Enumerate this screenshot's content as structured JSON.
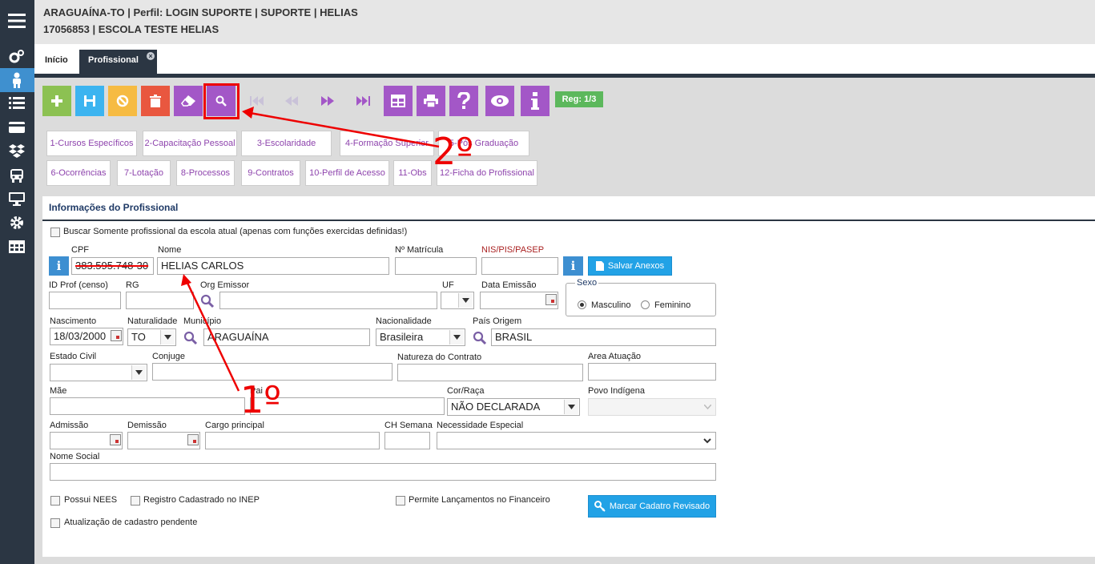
{
  "header": {
    "line1": "ARAGUAÍNA-TO | Perfil: LOGIN SUPORTE | SUPORTE | HELIAS",
    "line2": "17056853 | ESCOLA TESTE HELIAS"
  },
  "sidebar": {
    "items": [
      "menu-icon",
      "cogs-icon",
      "user-icon",
      "list-icon",
      "card-icon",
      "dropbox-icon",
      "bus-icon",
      "monitor-icon",
      "gear-icon",
      "table-icon"
    ]
  },
  "tabs": [
    {
      "label": "Início"
    },
    {
      "label": "Profissional",
      "close": "×"
    }
  ],
  "toolbar": {
    "reg": "Reg: 1/3",
    "colors": {
      "add": "#8cc152",
      "save": "#3cb4f0",
      "cancel": "#f6bb42",
      "delete": "#e9573f",
      "purple": "#a357c7"
    }
  },
  "subtabs_row1": [
    "1-Cursos Específicos",
    "2-Capacitação Pessoal",
    "3-Escolaridade",
    "4-Formação Superior",
    "5-Pós Graduação"
  ],
  "subtabs_row2": [
    "6-Ocorrências",
    "7-Lotação",
    "8-Processos",
    "9-Contratos",
    "10-Perfil de Acesso",
    "11-Obs",
    "12-Ficha do Profissional"
  ],
  "panel": {
    "title": "Informações do Profissional",
    "buscar": "Buscar Somente profissional da escola atual (apenas com funções exercidas definidas!)",
    "cpf": {
      "label": "CPF",
      "value": "383.595.748-30"
    },
    "nome": {
      "label": "Nome",
      "value": "HELIAS CARLOS"
    },
    "matricula": {
      "label": "Nº Matrícula",
      "value": ""
    },
    "nis": {
      "label": "NIS/PIS/PASEP",
      "value": ""
    },
    "salvar_anexos": "Salvar Anexos",
    "id_prof": {
      "label": "ID Prof (censo)",
      "value": ""
    },
    "rg": {
      "label": "RG",
      "value": ""
    },
    "org_emissor": {
      "label": "Org Emissor",
      "value": ""
    },
    "uf": {
      "label": "UF",
      "value": ""
    },
    "data_emissao": {
      "label": "Data Emissão",
      "value": ""
    },
    "sexo": {
      "label": "Sexo",
      "masculino": "Masculino",
      "feminino": "Feminino"
    },
    "nascimento": {
      "label": "Nascimento",
      "value": "18/03/2000"
    },
    "naturalidade": {
      "label": "Naturalidade",
      "value": "TO"
    },
    "municipio": {
      "label": "Município",
      "value": "ARAGUAÍNA"
    },
    "nacionalidade": {
      "label": "Nacionalidade",
      "value": "Brasileira"
    },
    "pais_origem": {
      "label": "País Origem",
      "value": "BRASIL"
    },
    "estado_civil": {
      "label": "Estado Civil",
      "value": ""
    },
    "conjuge": {
      "label": "Conjuge",
      "value": ""
    },
    "natureza": {
      "label": "Natureza do Contrato",
      "value": ""
    },
    "area": {
      "label": "Area Atuação",
      "value": ""
    },
    "mae": {
      "label": "Mãe",
      "value": ""
    },
    "pai": {
      "label": "Pai",
      "value": ""
    },
    "cor_raca": {
      "label": "Cor/Raça",
      "value": "NÃO DECLARADA"
    },
    "povo": {
      "label": "Povo Indígena",
      "value": ""
    },
    "admissao": {
      "label": "Admissão",
      "value": ""
    },
    "demissao": {
      "label": "Demissão",
      "value": ""
    },
    "cargo": {
      "label": "Cargo principal",
      "value": ""
    },
    "ch_semana": {
      "label": "CH Semana",
      "value": ""
    },
    "necessidade": {
      "label": "Necessidade Especial",
      "value": ""
    },
    "nome_social": {
      "label": "Nome Social",
      "value": ""
    },
    "possui_nees": "Possui NEES",
    "registro_inep": "Registro Cadastrado no INEP",
    "permite_lanc": "Permite Lançamentos no Financeiro",
    "atualizacao": "Atualização de cadastro pendente",
    "marcar": "Marcar Cadatro Revisado"
  },
  "annotations": {
    "first": "1º",
    "second": "2º",
    "color": "#ee0000"
  }
}
